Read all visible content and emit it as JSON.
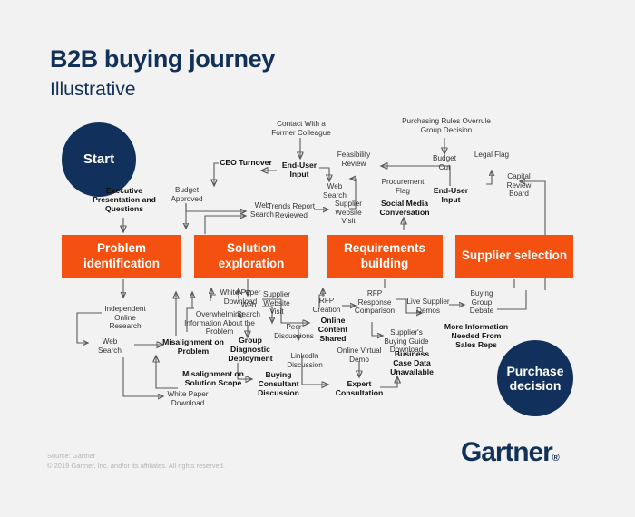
{
  "header": {
    "title": "B2B buying journey",
    "subtitle": "Illustrative"
  },
  "colors": {
    "navy": "#11305b",
    "orange": "#f4500f",
    "background": "#f2f2f2",
    "wire": "#5a5a5a",
    "footer_text": "#b4b4b4"
  },
  "circles": {
    "start": "Start",
    "purchase": "Purchase decision"
  },
  "stages": [
    {
      "label": "Problem identification"
    },
    {
      "label": "Solution exploration"
    },
    {
      "label": "Requirements building"
    },
    {
      "label": "Supplier selection"
    }
  ],
  "nodes_above": [
    {
      "id": "executive-presentation",
      "label": "Executive Presentation and Questions",
      "weight": "bold"
    },
    {
      "id": "ceo-turnover",
      "label": "CEO Turnover",
      "weight": "bold"
    },
    {
      "id": "budget-approved",
      "label": "Budget Approved",
      "weight": "regular"
    },
    {
      "id": "web-search-top-left",
      "label": "Web Search",
      "weight": "regular"
    },
    {
      "id": "contact-former-colleague",
      "label": "Contact With a Former Colleague",
      "weight": "regular"
    },
    {
      "id": "end-user-input-left",
      "label": "End-User Input",
      "weight": "bold"
    },
    {
      "id": "feasibility-review",
      "label": "Feasibility Review",
      "weight": "regular"
    },
    {
      "id": "web-search-top-mid",
      "label": "Web Search",
      "weight": "regular"
    },
    {
      "id": "trends-report-reviewed",
      "label": "Trends Report Reviewed",
      "weight": "regular"
    },
    {
      "id": "supplier-website-visit-top",
      "label": "Supplier Website Visit",
      "weight": "regular"
    },
    {
      "id": "procurement-flag",
      "label": "Procurement Flag",
      "weight": "regular"
    },
    {
      "id": "social-media-conversation",
      "label": "Social Media Conversation",
      "weight": "bold"
    },
    {
      "id": "purchasing-rules-overrule",
      "label": "Purchasing Rules Overrule Group Decision",
      "weight": "regular"
    },
    {
      "id": "budget-cut",
      "label": "Budget Cut",
      "weight": "regular"
    },
    {
      "id": "end-user-input-right",
      "label": "End-User Input",
      "weight": "bold"
    },
    {
      "id": "legal-flag",
      "label": "Legal Flag",
      "weight": "regular"
    },
    {
      "id": "capital-review-board",
      "label": "Capital Review Board",
      "weight": "regular"
    }
  ],
  "nodes_below": [
    {
      "id": "independent-online-research",
      "label": "Independent Online Research",
      "weight": "regular"
    },
    {
      "id": "web-search-bottom-left",
      "label": "Web Search",
      "weight": "regular"
    },
    {
      "id": "misalignment-on-problem",
      "label": "Misalignment on Problem",
      "weight": "bold"
    },
    {
      "id": "white-paper-download-left",
      "label": "White Paper Download",
      "weight": "regular"
    },
    {
      "id": "white-paper-download-top",
      "label": "White Paper Download",
      "weight": "regular"
    },
    {
      "id": "overwhelming-information",
      "label": "Overwhelming Information About the Problem",
      "weight": "regular"
    },
    {
      "id": "misalignment-on-solution-scope",
      "label": "Misalignment on Solution Scope",
      "weight": "bold"
    },
    {
      "id": "web-search-bottom-mid",
      "label": "Web Search",
      "weight": "regular"
    },
    {
      "id": "supplier-website-visit-bottom",
      "label": "Supplier Website Visit",
      "weight": "regular"
    },
    {
      "id": "group-diagnostic-deployment",
      "label": "Group Diagnostic Deployment",
      "weight": "bold"
    },
    {
      "id": "peer-discussions",
      "label": "Peer Discussions",
      "weight": "regular"
    },
    {
      "id": "buying-consultant-discussion",
      "label": "Buying Consultant Discussion",
      "weight": "bold"
    },
    {
      "id": "linkedin-discussion",
      "label": "LinkedIn Discussion",
      "weight": "regular"
    },
    {
      "id": "rfp-creation",
      "label": "RFP Creation",
      "weight": "regular"
    },
    {
      "id": "online-content-shared",
      "label": "Online Content Shared",
      "weight": "bold"
    },
    {
      "id": "rfp-response-comparison",
      "label": "RFP Response Comparison",
      "weight": "regular"
    },
    {
      "id": "suppliers-buying-guide-download",
      "label": "Supplier's Buying Guide Download",
      "weight": "regular"
    },
    {
      "id": "online-virtual-demo",
      "label": "Online Virtual Demo",
      "weight": "regular"
    },
    {
      "id": "expert-consultation",
      "label": "Expert Consultation",
      "weight": "bold"
    },
    {
      "id": "business-case-data-unavailable",
      "label": "Business Case Data Unavailable",
      "weight": "bold"
    },
    {
      "id": "live-supplier-demos",
      "label": "Live Supplier Demos",
      "weight": "regular"
    },
    {
      "id": "buying-group-debate",
      "label": "Buying Group Debate",
      "weight": "regular"
    },
    {
      "id": "more-information-needed",
      "label": "More Information Needed From Sales Reps",
      "weight": "bold"
    }
  ],
  "footer": {
    "source": "Source: Gartner",
    "copyright": "© 2019 Gartner, Inc. and/or its affiliates. All rights reserved.",
    "logo": "Gartner",
    "logo_mark": "®"
  }
}
